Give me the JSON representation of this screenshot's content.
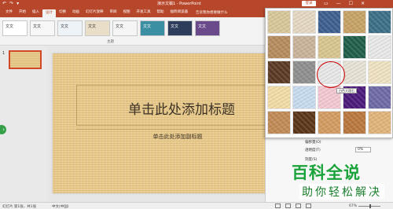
{
  "titlebar": {
    "quick_access": [
      "↶",
      "↷",
      "▾"
    ],
    "title": "演示文稿1 - PowerPoint",
    "login_label": "登录",
    "window_controls": [
      "▭",
      "—",
      "☐",
      "✕"
    ]
  },
  "tabs": [
    {
      "label": "文件",
      "active": false
    },
    {
      "label": "开始",
      "active": false
    },
    {
      "label": "插入",
      "active": false
    },
    {
      "label": "设计",
      "active": true
    },
    {
      "label": "切换",
      "active": false
    },
    {
      "label": "动画",
      "active": false
    },
    {
      "label": "幻灯片放映",
      "active": false
    },
    {
      "label": "审阅",
      "active": false
    },
    {
      "label": "视图",
      "active": false
    },
    {
      "label": "开发工具",
      "active": false
    },
    {
      "label": "帮助",
      "active": false
    },
    {
      "label": "福昕阅读器",
      "active": false
    }
  ],
  "tell_me": "告诉我你想要做什么",
  "ribbon": {
    "themes": [
      "文文",
      "文文",
      "文文",
      "文文",
      "文文",
      "文文",
      "文文",
      "文文"
    ],
    "group_label": "主题"
  },
  "thumbs": {
    "slide_number": "1"
  },
  "slide": {
    "title": "单击此处添加标题",
    "subtitle": "单击此处添加副标题"
  },
  "texture_panel": {
    "tooltip": "白色大理石",
    "textures": [
      {
        "name": "papyrus",
        "color": "#d9c79b"
      },
      {
        "name": "canvas",
        "color": "#e4d8c2"
      },
      {
        "name": "denim",
        "color": "#3d5f8f"
      },
      {
        "name": "woven-mat",
        "color": "#c7a266"
      },
      {
        "name": "water-droplets",
        "color": "#3b6f87"
      },
      {
        "name": "paper-bag",
        "color": "#b58c5e"
      },
      {
        "name": "fish-fossil",
        "color": "#c9b29a"
      },
      {
        "name": "sand",
        "color": "#d8c58f"
      },
      {
        "name": "green-marble",
        "color": "#1f5e48"
      },
      {
        "name": "white-marble",
        "color": "#e8e8e8"
      },
      {
        "name": "brown-marble",
        "color": "#5a3a24"
      },
      {
        "name": "granite",
        "color": "#8f8f8f"
      },
      {
        "name": "newsprint",
        "color": "#e7e7e7"
      },
      {
        "name": "recycled-paper",
        "color": "#e7e2d6"
      },
      {
        "name": "parchment",
        "color": "#efe2c3"
      },
      {
        "name": "stationery",
        "color": "#f1dca6"
      },
      {
        "name": "blue-tissue",
        "color": "#c6dbef"
      },
      {
        "name": "pink-tissue",
        "color": "#f3c8d2"
      },
      {
        "name": "purple-mesh",
        "color": "#4b1a7a"
      },
      {
        "name": "bouquet",
        "color": "#6e6aa6"
      },
      {
        "name": "cork",
        "color": "#c08a55"
      },
      {
        "name": "walnut",
        "color": "#5a3519"
      },
      {
        "name": "oak",
        "color": "#d39b61"
      },
      {
        "name": "medium-wood",
        "color": "#b9773e"
      },
      {
        "name": "light-wood",
        "color": "#e0b47a"
      }
    ]
  },
  "format_pane": {
    "tile_label": "偏移量(O)",
    "transparency_label": "透明度(T)",
    "transparency_value": "0%",
    "offset_label": "刻度(S)"
  },
  "watermark": {
    "big": "百科全说",
    "small": "助你轻松解决"
  },
  "statusbar": {
    "slide_info": "幻灯片 第1张，共1张",
    "language": "中文(中国)",
    "zoom": "67%"
  }
}
